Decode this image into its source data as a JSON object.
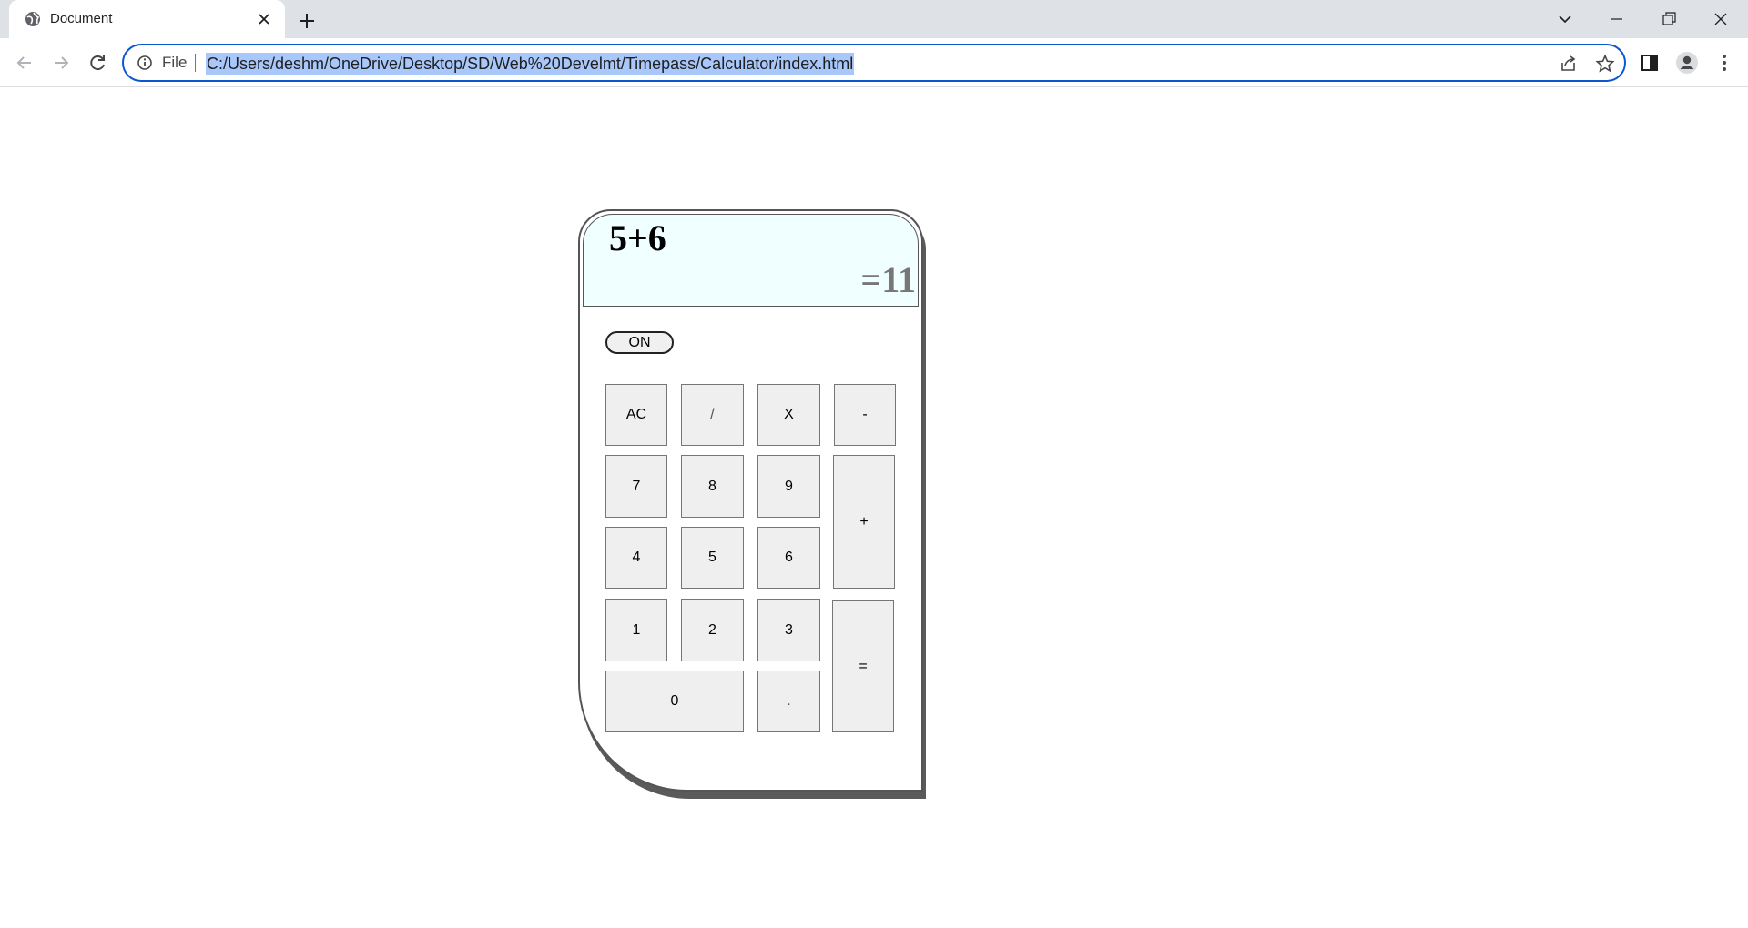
{
  "browser": {
    "tab": {
      "title": "Document",
      "favicon": "globe-icon",
      "close_icon": "close-icon"
    },
    "new_tab_icon": "plus-icon",
    "window_controls": [
      "tab-search-icon",
      "minimize-icon",
      "restore-icon",
      "close-icon"
    ],
    "nav": [
      "back-icon",
      "forward-icon",
      "reload-icon"
    ],
    "omnibox": {
      "security_label": "File",
      "url": "C:/Users/deshm/OneDrive/Desktop/SD/Web%20Develmt/Timepass/Calculator/index.html"
    },
    "toolbar_icons": [
      "share-icon",
      "bookmark-star-icon",
      "side-panel-icon",
      "profile-icon",
      "menu-icon"
    ]
  },
  "calculator": {
    "display": {
      "expression": "5+6",
      "result": "=11"
    },
    "on_label": "ON",
    "keys": {
      "ac": "AC",
      "divide": "/",
      "multiply": "X",
      "minus": "-",
      "seven": "7",
      "eight": "8",
      "nine": "9",
      "plus": "+",
      "four": "4",
      "five": "5",
      "six": "6",
      "one": "1",
      "two": "2",
      "three": "3",
      "equals": "=",
      "zero": "0",
      "dot": "."
    },
    "colors": {
      "display_bg": "#f0ffff",
      "key_bg": "#efefef",
      "result_text": "#777777"
    }
  }
}
